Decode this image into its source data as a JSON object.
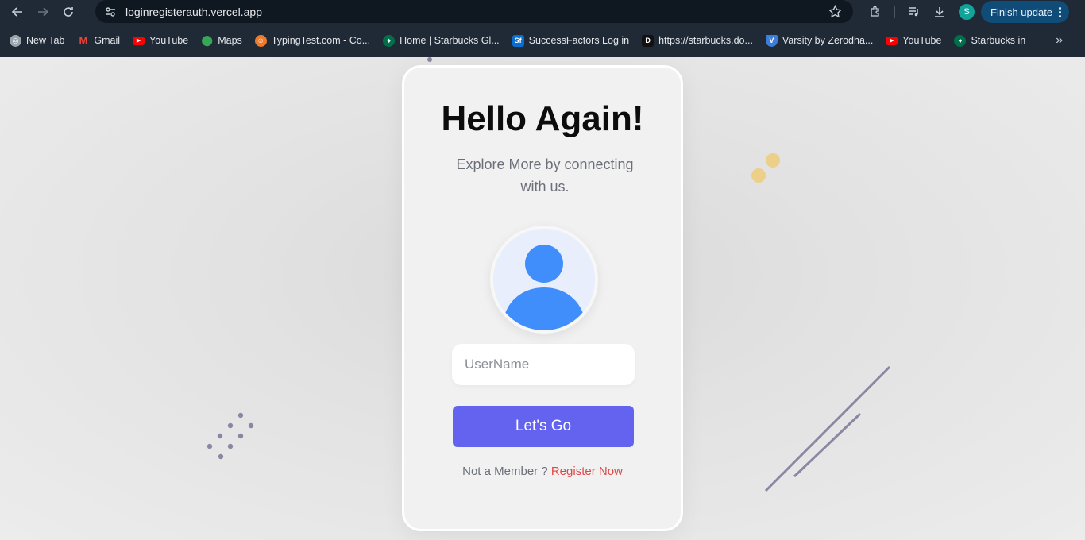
{
  "browser": {
    "url": "loginregisterauth.vercel.app",
    "profile_initial": "S",
    "update_label": "Finish update"
  },
  "bookmarks": [
    {
      "label": "New Tab",
      "icon": "globe-icon",
      "color": "#9aa4ad"
    },
    {
      "label": "Gmail",
      "icon": "gmail-icon",
      "color": "#ea4335"
    },
    {
      "label": "YouTube",
      "icon": "youtube-icon",
      "color": "#ff0000"
    },
    {
      "label": "Maps",
      "icon": "maps-icon",
      "color": "#34a853"
    },
    {
      "label": "TypingTest.com - Co...",
      "icon": "typingtest-icon",
      "color": "#f07a2a"
    },
    {
      "label": "Home | Starbucks Gl...",
      "icon": "starbucks-icon",
      "color": "#00704a"
    },
    {
      "label": "SuccessFactors Log in",
      "icon": "sf-icon",
      "color": "#0a6ed1"
    },
    {
      "label": "https://starbucks.do...",
      "icon": "d-icon",
      "color": "#111111"
    },
    {
      "label": "Varsity by Zerodha...",
      "icon": "varsity-icon",
      "color": "#3b7ddd"
    },
    {
      "label": "YouTube",
      "icon": "youtube-icon",
      "color": "#ff0000"
    },
    {
      "label": "Starbucks in",
      "icon": "starbucks-icon",
      "color": "#00704a"
    }
  ],
  "login": {
    "title": "Hello Again!",
    "subtitle": "Explore More by connecting with us.",
    "username_placeholder": "UserName",
    "submit_label": "Let's Go",
    "member_prompt": "Not a Member ?",
    "register_label": "Register Now"
  },
  "colors": {
    "accent": "#6363ef",
    "register_link": "#e04848",
    "avatar_blue": "#3f8efc"
  }
}
